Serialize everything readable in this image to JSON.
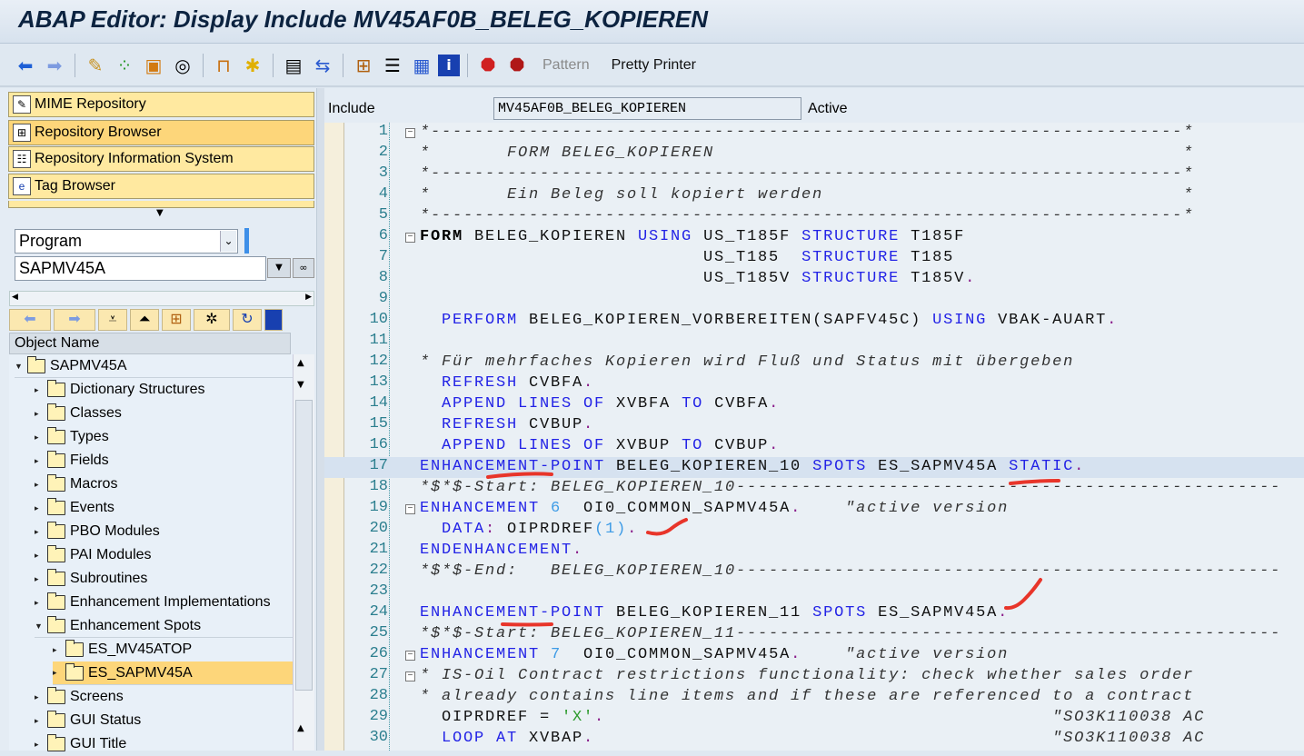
{
  "title": "ABAP Editor: Display Include MV45AF0B_BELEG_KOPIEREN",
  "toolbar": {
    "icons": [
      "back-arrow",
      "forward-arrow",
      "display-change-pencil",
      "check-syntax",
      "activate",
      "where-used-list",
      "other-object",
      "enhance",
      "display-object-list",
      "navigation-window",
      "hierarchy",
      "stack",
      "list",
      "info",
      "set-breakpoint",
      "set-session-breakpoint"
    ],
    "pattern_label": "Pattern",
    "pretty_printer_label": "Pretty Printer"
  },
  "nav": {
    "buttons": [
      "MIME Repository",
      "Repository Browser",
      "Repository Information System",
      "Tag Browser"
    ],
    "selected": "Repository Browser"
  },
  "object_type": {
    "selected": "Program"
  },
  "object_name_value": "SAPMV45A",
  "tree": {
    "header": "Object Name",
    "root": "SAPMV45A",
    "items": [
      {
        "label": "Dictionary Structures",
        "level": 1
      },
      {
        "label": "Classes",
        "level": 1
      },
      {
        "label": "Types",
        "level": 1
      },
      {
        "label": "Fields",
        "level": 1
      },
      {
        "label": "Macros",
        "level": 1
      },
      {
        "label": "Events",
        "level": 1
      },
      {
        "label": "PBO Modules",
        "level": 1
      },
      {
        "label": "PAI Modules",
        "level": 1
      },
      {
        "label": "Subroutines",
        "level": 1
      },
      {
        "label": "Enhancement Implementations",
        "level": 1
      },
      {
        "label": "Enhancement Spots",
        "level": 1,
        "expanded": true
      },
      {
        "label": "ES_MV45ATOP",
        "level": 2
      },
      {
        "label": "ES_SAPMV45A",
        "level": 2,
        "selected": true
      },
      {
        "label": "Screens",
        "level": 1
      },
      {
        "label": "GUI Status",
        "level": 1
      },
      {
        "label": "GUI Title",
        "level": 1
      }
    ]
  },
  "editor": {
    "include_label": "Include",
    "include_value": "MV45AF0B_BELEG_KOPIEREN",
    "status": "Active",
    "lines": [
      [
        [
          "cm",
          "*---------------------------------------------------------------------*"
        ]
      ],
      [
        [
          "cm",
          "*       FORM BELEG_KOPIEREN                                           *"
        ]
      ],
      [
        [
          "cm",
          "*---------------------------------------------------------------------*"
        ]
      ],
      [
        [
          "cm",
          "*       Ein Beleg soll kopiert werden                                 *"
        ]
      ],
      [
        [
          "cm",
          "*---------------------------------------------------------------------*"
        ]
      ],
      [
        [
          "kwb",
          "FORM"
        ],
        [
          "id",
          " BELEG_KOPIEREN "
        ],
        [
          "kw",
          "USING"
        ],
        [
          "id",
          " US_T185F "
        ],
        [
          "kw",
          "STRUCTURE"
        ],
        [
          "id",
          " T185F"
        ]
      ],
      [
        [
          "id",
          "                          US_T185  "
        ],
        [
          "kw",
          "STRUCTURE"
        ],
        [
          "id",
          " T185"
        ]
      ],
      [
        [
          "id",
          "                          US_T185V "
        ],
        [
          "kw",
          "STRUCTURE"
        ],
        [
          "id",
          " T185V"
        ],
        [
          "pu",
          "."
        ]
      ],
      [],
      [
        [
          "id",
          "  "
        ],
        [
          "kw",
          "PERFORM"
        ],
        [
          "id",
          " BELEG_KOPIEREN_VORBEREITEN(SAPFV45C) "
        ],
        [
          "kw",
          "USING"
        ],
        [
          "id",
          " VBAK-AUART"
        ],
        [
          "pu",
          "."
        ]
      ],
      [],
      [
        [
          "cm",
          "* Für mehrfaches Kopieren wird Fluß und Status mit übergeben"
        ]
      ],
      [
        [
          "id",
          "  "
        ],
        [
          "kw",
          "REFRESH"
        ],
        [
          "id",
          " CVBFA"
        ],
        [
          "pu",
          "."
        ]
      ],
      [
        [
          "id",
          "  "
        ],
        [
          "kw",
          "APPEND LINES OF"
        ],
        [
          "id",
          " XVBFA "
        ],
        [
          "kw",
          "TO"
        ],
        [
          "id",
          " CVBFA"
        ],
        [
          "pu",
          "."
        ]
      ],
      [
        [
          "id",
          "  "
        ],
        [
          "kw",
          "REFRESH"
        ],
        [
          "id",
          " CVBUP"
        ],
        [
          "pu",
          "."
        ]
      ],
      [
        [
          "id",
          "  "
        ],
        [
          "kw",
          "APPEND LINES OF"
        ],
        [
          "id",
          " XVBUP "
        ],
        [
          "kw",
          "TO"
        ],
        [
          "id",
          " CVBUP"
        ],
        [
          "pu",
          "."
        ]
      ],
      [
        [
          "kw",
          "ENHANCEMENT-POINT"
        ],
        [
          "id",
          " BELEG_KOPIEREN_10 "
        ],
        [
          "kw",
          "SPOTS"
        ],
        [
          "id",
          " ES_SAPMV45A "
        ],
        [
          "kw",
          "STATIC"
        ],
        [
          "pu",
          "."
        ]
      ],
      [
        [
          "cm",
          "*$*$-Start: BELEG_KOPIEREN_10--------------------------------------------------"
        ]
      ],
      [
        [
          "kw",
          "ENHANCEMENT"
        ],
        [
          "num",
          " 6"
        ],
        [
          "id",
          "  OI0_COMMON_SAPMV45A"
        ],
        [
          "pu",
          "."
        ],
        [
          "cm",
          "    \"active version"
        ]
      ],
      [
        [
          "id",
          "  "
        ],
        [
          "kw",
          "DATA"
        ],
        [
          "pu",
          ":"
        ],
        [
          "id",
          " OIPRDREF"
        ],
        [
          "num",
          "(1)"
        ],
        [
          "pu",
          "."
        ]
      ],
      [
        [
          "kw",
          "ENDENHANCEMENT"
        ],
        [
          "pu",
          "."
        ]
      ],
      [
        [
          "cm",
          "*$*$-End:   BELEG_KOPIEREN_10--------------------------------------------------"
        ]
      ],
      [],
      [
        [
          "kw",
          "ENHANCEMENT-POINT"
        ],
        [
          "id",
          " BELEG_KOPIEREN_11 "
        ],
        [
          "kw",
          "SPOTS"
        ],
        [
          "id",
          " ES_SAPMV45A"
        ],
        [
          "pu",
          "."
        ]
      ],
      [
        [
          "cm",
          "*$*$-Start: BELEG_KOPIEREN_11--------------------------------------------------"
        ]
      ],
      [
        [
          "kw",
          "ENHANCEMENT"
        ],
        [
          "num",
          " 7"
        ],
        [
          "id",
          "  OI0_COMMON_SAPMV45A"
        ],
        [
          "pu",
          "."
        ],
        [
          "cm",
          "    \"active version"
        ]
      ],
      [
        [
          "cm",
          "* IS-Oil Contract restrictions functionality: check whether sales order"
        ]
      ],
      [
        [
          "cm",
          "* already contains line items and if these are referenced to a contract"
        ]
      ],
      [
        [
          "id",
          "  OIPRDREF = "
        ],
        [
          "str",
          "'X'"
        ],
        [
          "pu",
          "."
        ],
        [
          "id",
          "                                         "
        ],
        [
          "cm",
          "\"SO3K110038 AC"
        ]
      ],
      [
        [
          "id",
          "  "
        ],
        [
          "kw",
          "LOOP AT"
        ],
        [
          "id",
          " XVBAP"
        ],
        [
          "pu",
          "."
        ],
        [
          "id",
          "                                          "
        ],
        [
          "cm",
          "\"SO3K110038 AC"
        ]
      ]
    ],
    "highlighted_line": 17,
    "fold_lines": [
      1,
      6,
      19,
      26,
      27
    ]
  },
  "colors": {
    "keyword": "#2323e6",
    "line_number": "#2c7f8f",
    "selection": "#fdd67a",
    "annotation": "#e8352a"
  }
}
